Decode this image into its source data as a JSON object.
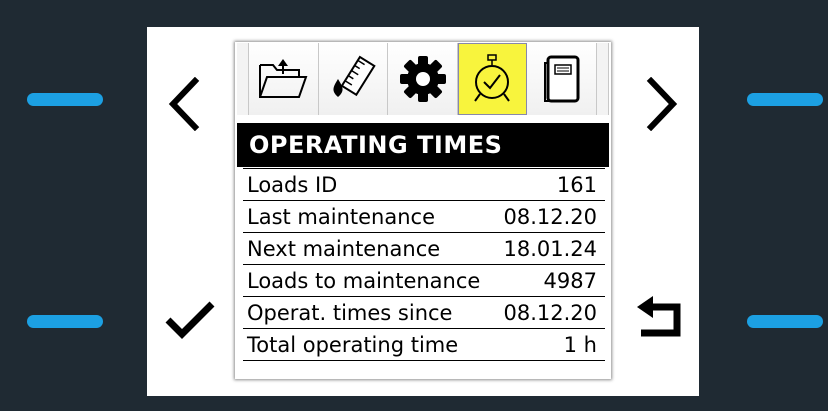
{
  "screen": {
    "title": "OPERATING TIMES",
    "rows": [
      {
        "label": "Loads ID",
        "value": "161"
      },
      {
        "label": "Last maintenance",
        "value": "08.12.20"
      },
      {
        "label": "Next maintenance",
        "value": "18.01.24"
      },
      {
        "label": "Loads to maintenance",
        "value": "4987"
      },
      {
        "label": "Operat. times since",
        "value": "08.12.20"
      },
      {
        "label": "Total operating time",
        "value": "1 h"
      }
    ]
  },
  "tabs": [
    {
      "icon": "folder-upload-icon"
    },
    {
      "icon": "measure-drop-icon"
    },
    {
      "icon": "gear-icon"
    },
    {
      "icon": "alarm-clock-icon",
      "active": true
    },
    {
      "icon": "document-icon"
    }
  ],
  "colors": {
    "background": "#1f2a33",
    "softkey": "#1ca0e3",
    "active_tab": "#f8f43d",
    "title_bar": "#000000"
  }
}
